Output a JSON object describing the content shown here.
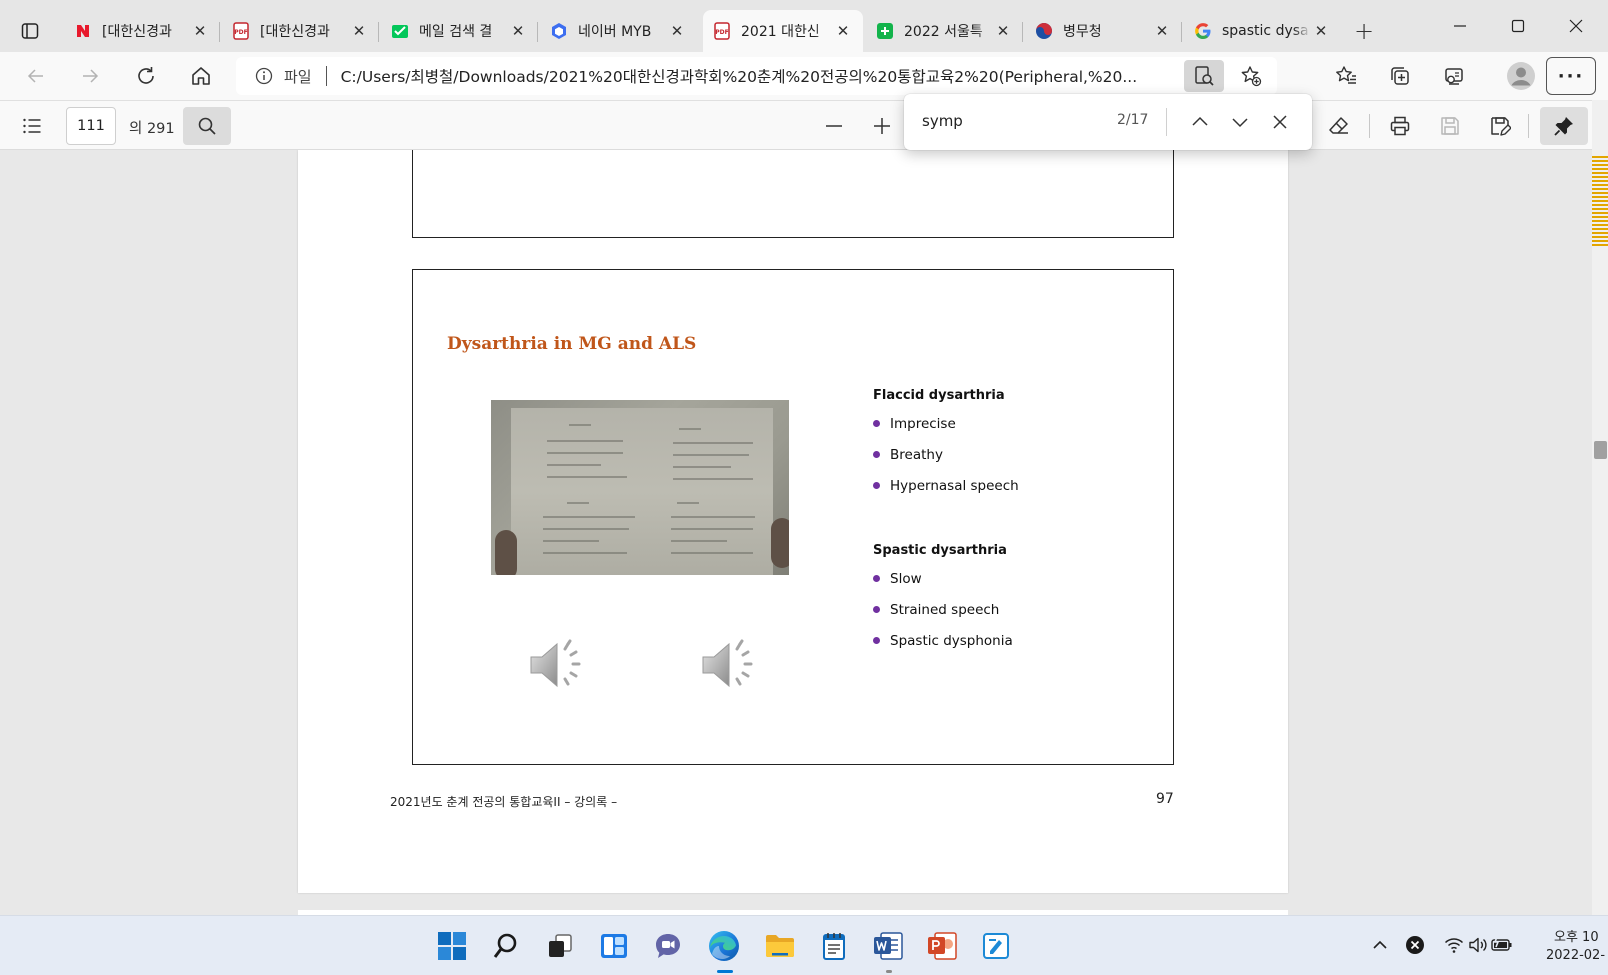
{
  "colors": {
    "tab_strip": "#e6e6e6",
    "toolbar": "#f9f9f9",
    "slide_title": "#c0561a",
    "bullet": "#7030a0",
    "find_highlight": "#e3a600",
    "taskbar": "#e5ebf5"
  },
  "tabs": [
    {
      "label": "[대한신경과",
      "icon": "naver-n-icon",
      "active": false
    },
    {
      "label": "[대한신경과",
      "icon": "pdf-icon",
      "active": false
    },
    {
      "label": "메일 검색 결",
      "icon": "mail-icon",
      "active": false
    },
    {
      "label": "네이버 MYB",
      "icon": "myb-cube-icon",
      "active": false
    },
    {
      "label": "2021 대한신",
      "icon": "pdf-icon",
      "active": true
    },
    {
      "label": "2022 서울특",
      "icon": "green-app-icon",
      "active": false
    },
    {
      "label": "병무청",
      "icon": "taegeuk-icon",
      "active": false
    },
    {
      "label": "spastic dysa",
      "icon": "google-g-icon",
      "active": false
    }
  ],
  "address": {
    "scheme_label": "파일",
    "url": "C:/Users/최병철/Downloads/2021%20대한신경과학회%20춘계%20전공의%20통합교육2%20(Peripheral,%20..."
  },
  "pdf_toolbar": {
    "page_number": "111",
    "page_total": "의 291"
  },
  "find": {
    "query": "symp",
    "count": "2/17"
  },
  "slide": {
    "title": "Dysarthria in MG and ALS",
    "sections": [
      {
        "title": "Flaccid dysarthria",
        "items": [
          "Imprecise",
          "Breathy",
          "Hypernasal speech"
        ]
      },
      {
        "title": "Spastic dysarthria",
        "items": [
          "Slow",
          "Strained speech",
          "Spastic dysphonia"
        ]
      }
    ]
  },
  "footer": {
    "left": "2021년도 춘계 전공의 통합교육II  – 강의록 –",
    "page": "97"
  },
  "clock": {
    "time": "오후 10",
    "date": "2022-02-"
  }
}
